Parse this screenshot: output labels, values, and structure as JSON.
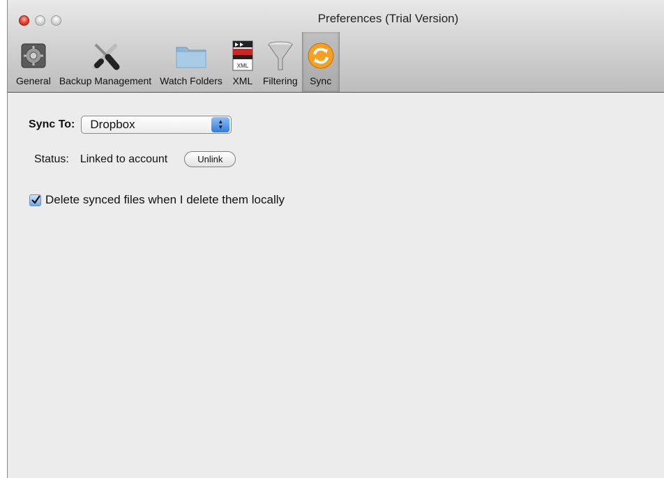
{
  "window": {
    "title": "Preferences (Trial Version)"
  },
  "toolbar": {
    "items": [
      {
        "label": "General",
        "icon": "general-prefs-icon"
      },
      {
        "label": "Backup Management",
        "icon": "tools-icon"
      },
      {
        "label": "Watch Folders",
        "icon": "folder-icon"
      },
      {
        "label": "XML",
        "icon": "xml-file-icon"
      },
      {
        "label": "Filtering",
        "icon": "funnel-icon"
      },
      {
        "label": "Sync",
        "icon": "sync-icon"
      }
    ],
    "selected": "Sync"
  },
  "sync": {
    "label": "Sync To:",
    "selected_value": "Dropbox",
    "status_label": "Status:",
    "status_value": "Linked to account",
    "unlink_label": "Unlink",
    "delete_option_label": "Delete synced files when I delete them locally",
    "delete_option_checked": true
  }
}
